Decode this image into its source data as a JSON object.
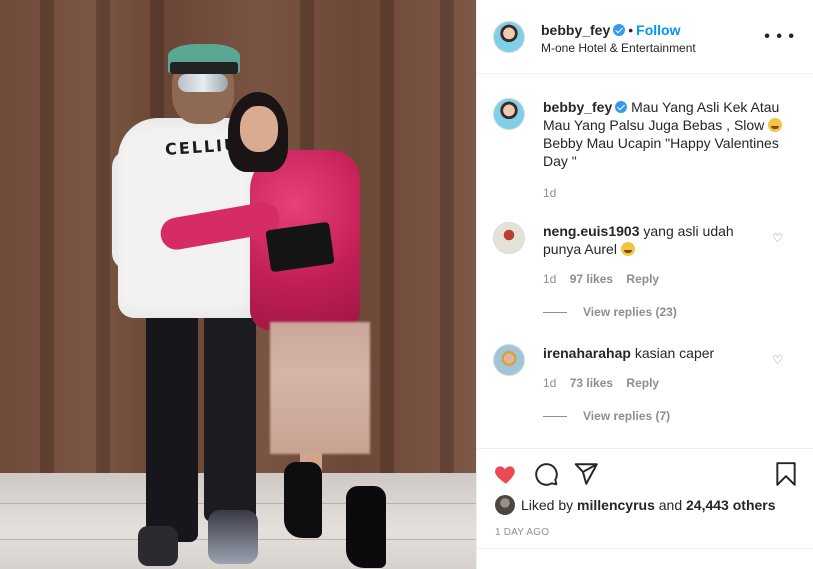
{
  "post": {
    "author": {
      "username": "bebby_fey",
      "verified": true,
      "follow_label": "Follow",
      "location": "M-one Hotel & Entertainment"
    },
    "more_icon": "more-horizontal-icon",
    "caption": {
      "username": "bebby_fey",
      "text": "Mau Yang Asli Kek Atau Mau Yang Palsu Juga Bebas , Slow",
      "text_after_emoji": "Bebby Mau Ucapin \"Happy Valentines Day \"",
      "age": "1d"
    },
    "comments": [
      {
        "username": "neng.euis1903",
        "text": "yang asli udah punya Aurel",
        "age": "1d",
        "likes": "97 likes",
        "reply_label": "Reply",
        "view_replies": "View replies (23)"
      },
      {
        "username": "irenaharahap",
        "text": "kasian caper",
        "age": "1d",
        "likes": "73 likes",
        "reply_label": "Reply",
        "view_replies": "View replies (7)"
      }
    ],
    "actions": {
      "like_icon": "heart-filled-icon",
      "comment_icon": "comment-icon",
      "share_icon": "send-icon",
      "save_icon": "bookmark-icon",
      "like_color": "#ed4956"
    },
    "liked_by": {
      "prefix": "Liked by",
      "user": "millencyrus",
      "connector": "and",
      "others": "24,443 others"
    },
    "timestamp": "1 DAY AGO"
  }
}
